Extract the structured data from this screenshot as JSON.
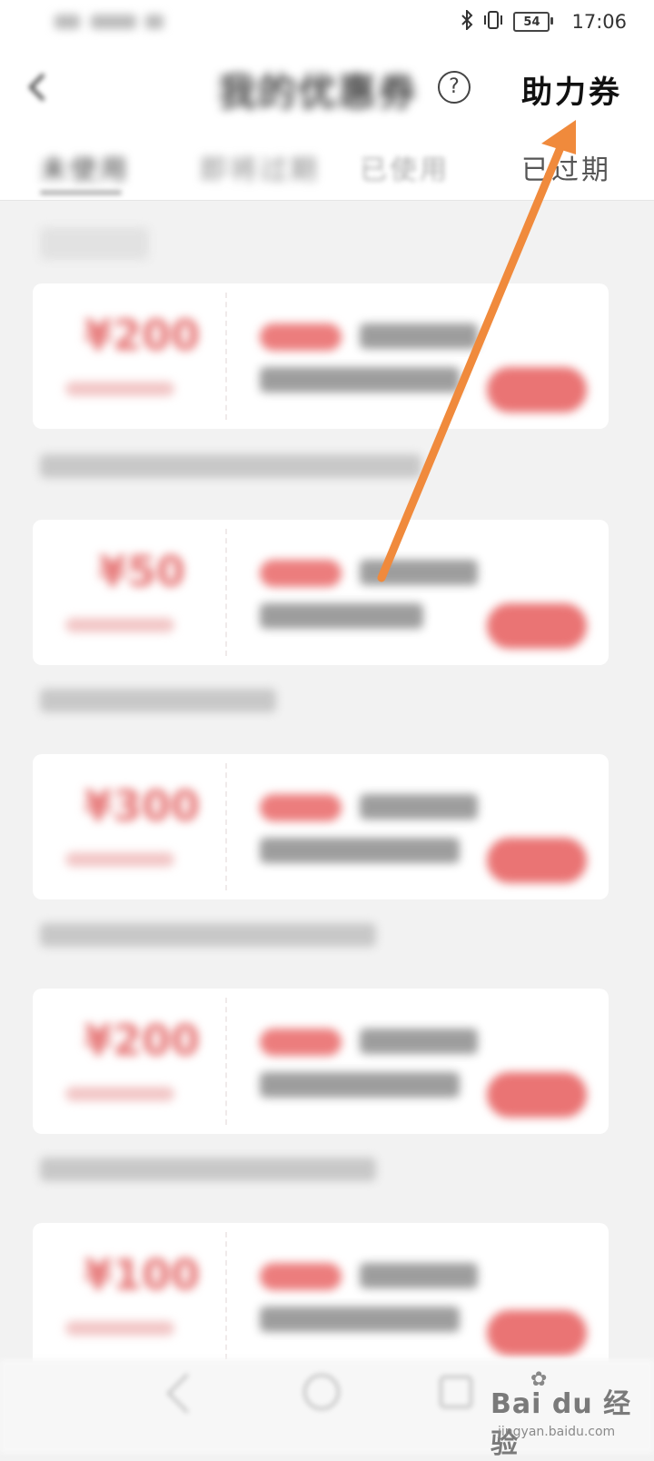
{
  "status_bar": {
    "time": "17:06",
    "battery": "54",
    "icons": [
      "bluetooth-icon",
      "vibrate-icon",
      "battery-icon"
    ]
  },
  "header": {
    "title": "我的优惠券",
    "help_icon": "?",
    "assist_link": "助力券"
  },
  "tabs": [
    {
      "label": "未使用"
    },
    {
      "label": "即将过期"
    },
    {
      "label": "已使用"
    },
    {
      "label": "已过期"
    }
  ],
  "coupons": [
    {
      "amount": "¥200"
    },
    {
      "amount": "¥50"
    },
    {
      "amount": "¥300"
    },
    {
      "amount": "¥200"
    },
    {
      "amount": "¥100"
    }
  ],
  "watermark": {
    "brand": "Bai du 经验",
    "url": "jingyan.baidu.com"
  },
  "colors": {
    "accent": "#ea7474",
    "annotation_arrow": "#f08a3c"
  }
}
